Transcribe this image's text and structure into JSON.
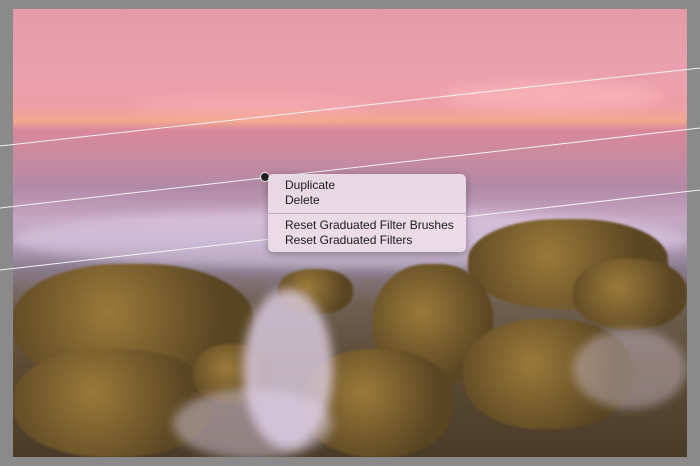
{
  "context_menu": {
    "items": [
      "Duplicate",
      "Delete"
    ],
    "reset_items": [
      "Reset Graduated Filter Brushes",
      "Reset Graduated Filters"
    ]
  },
  "tool": {
    "name_icon": "graduated-filter-pin-icon"
  }
}
